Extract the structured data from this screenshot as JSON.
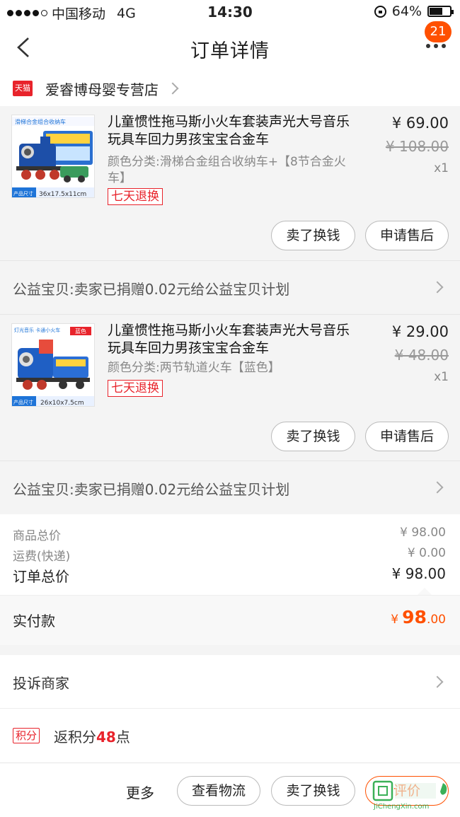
{
  "status": {
    "carrier": "中国移动",
    "network": "4G",
    "time": "14:30",
    "battery": "64%",
    "battery_level": 0.64
  },
  "nav": {
    "title": "订单详情",
    "badge": "21"
  },
  "shop": {
    "platform_badge": "天猫",
    "name": "爱睿博母婴专营店"
  },
  "items": [
    {
      "title": "儿童惯性拖马斯小火车套装声光大号音乐玩具车回力男孩宝宝合金车",
      "spec": "颜色分类:滑梯合金组合收纳车+【8节合金火车】",
      "tag": "七天退换",
      "price": "¥ 69.00",
      "original_price": "¥ 108.00",
      "qty": "x1",
      "thumb_header": "滑梯合金组合收纳车",
      "thumb_size": "36x17.5x11cm",
      "thumb_size_label": "产品尺寸",
      "sell_button": "卖了换钱",
      "service_button": "申请售后"
    },
    {
      "title": "儿童惯性拖马斯小火车套装声光大号音乐玩具车回力男孩宝宝合金车",
      "spec": "颜色分类:两节轨道火车【蓝色】",
      "tag": "七天退换",
      "price": "¥ 29.00",
      "original_price": "¥ 48.00",
      "qty": "x1",
      "thumb_header": "灯光音乐 卡通小火车",
      "thumb_color": "蓝色",
      "thumb_size": "26x10x7.5cm",
      "thumb_size_label": "产品尺寸",
      "sell_button": "卖了换钱",
      "service_button": "申请售后"
    }
  ],
  "charity_text": "公益宝贝:卖家已捐赠0.02元给公益宝贝计划",
  "summary": {
    "goods_label": "商品总价",
    "goods_value": "¥ 98.00",
    "shipping_label": "运费(快递)",
    "shipping_value": "¥ 0.00",
    "total_label": "订单总价",
    "total_value": "¥ 98.00",
    "paid_label": "实付款",
    "paid_currency": "¥",
    "paid_int": "98",
    "paid_dec": ".00"
  },
  "complain": "投诉商家",
  "points": {
    "badge": "积分",
    "prefix": "返积分",
    "value": "48",
    "suffix": "点"
  },
  "actions": {
    "more": "更多",
    "logistics": "查看物流",
    "sell": "卖了换钱",
    "evaluate": "评价"
  },
  "watermark": "JiChengXin.com",
  "colors": {
    "accent": "#ff5000",
    "tmall_red": "#e8232b"
  }
}
